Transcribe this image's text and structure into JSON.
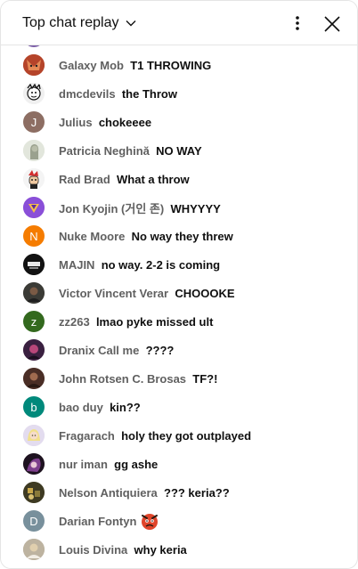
{
  "header": {
    "title": "Top chat replay"
  },
  "messages": [
    {
      "author": "Galaxy Mob",
      "text": "T1 THROWING",
      "avatar_color": "#c0563a",
      "avatar_letter": ""
    },
    {
      "author": "dmcdevils",
      "text": "the Throw",
      "avatar_color": "#e9e9e9",
      "avatar_letter": ""
    },
    {
      "author": "Julius",
      "text": "chokeeee",
      "avatar_color": "#8d6e63",
      "avatar_letter": "J"
    },
    {
      "author": "Patricia Neghină",
      "text": "NO WAY",
      "avatar_color": "#cfd4c8",
      "avatar_letter": ""
    },
    {
      "author": "Rad Brad",
      "text": "What a throw",
      "avatar_color": "#f3f3f3",
      "avatar_letter": ""
    },
    {
      "author": "Jon Kyojin (거인 존)",
      "text": "WHYYYY",
      "avatar_color": "#8a4fd8",
      "avatar_letter": ""
    },
    {
      "author": "Nuke Moore",
      "text": "No way they threw",
      "avatar_color": "#f57c00",
      "avatar_letter": "N"
    },
    {
      "author": "MAJIN",
      "text": "no way. 2-2 is coming",
      "avatar_color": "#111111",
      "avatar_letter": ""
    },
    {
      "author": "Victor Vincent Verar",
      "text": "CHOOOKE",
      "avatar_color": "#3b3b36",
      "avatar_letter": ""
    },
    {
      "author": "zz263",
      "text": "lmao pyke missed ult",
      "avatar_color": "#33691e",
      "avatar_letter": "z"
    },
    {
      "author": "Dranix Call me",
      "text": "????",
      "avatar_color": "#4a2a4e",
      "avatar_letter": ""
    },
    {
      "author": "John Rotsen C. Brosas",
      "text": "TF?!",
      "avatar_color": "#5a3a30",
      "avatar_letter": ""
    },
    {
      "author": "bao duy",
      "text": "kin??",
      "avatar_color": "#00897b",
      "avatar_letter": "b"
    },
    {
      "author": "Fragarach",
      "text": "holy they got outplayed",
      "avatar_color": "#d9cfe6",
      "avatar_letter": ""
    },
    {
      "author": "nur iman",
      "text": "gg ashe",
      "avatar_color": "#2b2b2b",
      "avatar_letter": ""
    },
    {
      "author": "Nelson Antiquiera",
      "text": "??? keria??",
      "avatar_color": "#4d4a2a",
      "avatar_letter": ""
    },
    {
      "author": "Darian Fontyn",
      "text": "",
      "avatar_color": "#78909c",
      "avatar_letter": "D"
    },
    {
      "author": "Louis Divina",
      "text": "why keria",
      "avatar_color": "#a89b86",
      "avatar_letter": ""
    }
  ]
}
